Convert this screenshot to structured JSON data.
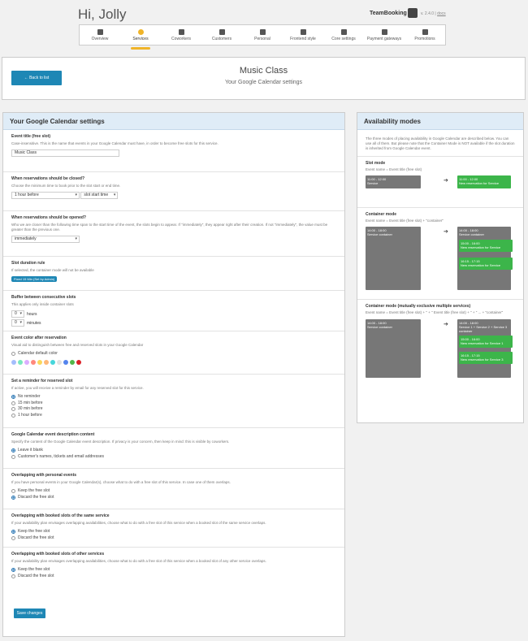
{
  "header": {
    "greeting": "Hi, Jolly",
    "brand": "TeamBooking",
    "version": "v. 2.4.0",
    "docs_link": "docs"
  },
  "nav": {
    "items": [
      {
        "label": "Overview",
        "icon": "overview-icon"
      },
      {
        "label": "Services",
        "icon": "services-icon",
        "active": true
      },
      {
        "label": "Coworkers",
        "icon": "coworkers-icon"
      },
      {
        "label": "Customers",
        "icon": "customers-icon"
      },
      {
        "label": "Personal",
        "icon": "personal-icon"
      },
      {
        "label": "Frontend style",
        "icon": "brush-icon"
      },
      {
        "label": "Core settings",
        "icon": "gear-icon"
      },
      {
        "label": "Payment gateways",
        "icon": "cart-icon"
      },
      {
        "label": "Promotions",
        "icon": "promo-icon"
      }
    ],
    "accent": "#f0b429"
  },
  "titlebar": {
    "back_label": "← Back to list",
    "service_name": "Music Class",
    "subtitle": "Your Google Calendar settings"
  },
  "settings": {
    "title": "Your Google Calendar settings",
    "event_title": {
      "label": "Event title (free slot)",
      "desc": "Case-insensitive. This is the name that events in your Google Calendar must have, in order to become free slots for this service.",
      "value": "Music Class"
    },
    "close": {
      "label": "When reservations should be closed?",
      "desc": "Choose the minimum time to book prior to the slot start or end time.",
      "sel1": "1 hour before",
      "sel2": "slot start time"
    },
    "open": {
      "label": "When reservations should be opened?",
      "desc": "Who we are closer than the following time span to the start time of the event, the slots begin to appear. If \"immediately\", they appear right after their creation. If not \"immediately\", the value must be greater than the previous one.",
      "sel": "immediately"
    },
    "duration": {
      "label": "Slot duration rule",
      "desc": "If selected, the container mode will not be available",
      "pill1": "Fixed 15 Min",
      "pill2": "(Set by Admin)"
    },
    "buffer": {
      "label": "Buffer between consecutive slots",
      "desc": "This applies only inside container slots",
      "hours_val": "0",
      "hours_label": "hours",
      "minutes_val": "0",
      "minutes_label": "minutes"
    },
    "color": {
      "label": "Event color after reservation",
      "desc": "Visual aid to distinguish between free and reserved slots in your Google Calendar",
      "default_label": "Calendar default color",
      "swatches": [
        "#a4bdfc",
        "#7ae7bf",
        "#dbadff",
        "#ff887c",
        "#fbd75b",
        "#ffb878",
        "#46d6db",
        "#e1e1e1",
        "#5484ed",
        "#51b749",
        "#dc2127"
      ]
    },
    "reminder": {
      "label": "Set a reminder for reserved slot",
      "desc": "If active, you will receive a reminder by email for any reserved slot for this service.",
      "options": [
        "No reminder",
        "15 min before",
        "30 min before",
        "1 hour before"
      ],
      "selected": 0
    },
    "description": {
      "label": "Google Calendar event description content",
      "desc": "Specify the content of the Google Calendar event description. If privacy is your concern, then keep in mind: this is visible by coworkers.",
      "options": [
        "Leave it blank",
        "Customer's names, tickets and email addresses"
      ],
      "selected": 0
    },
    "personal": {
      "label": "Overlapping with personal events",
      "desc": "If you have personal events in your Google Calendar(s), choose what to do with a free slot of this service. In case one of them overlaps.",
      "options": [
        "Keep the free slot",
        "Discard the free slot"
      ],
      "selected": 1
    },
    "same_service": {
      "label": "Overlapping with booked slots of the same service",
      "desc": "If your availability plan envisages overlapping availabilities, choose what to do with a free slot of this service when a booked slot of the same service overlaps.",
      "options": [
        "Keep the free slot",
        "Discard the free slot"
      ],
      "selected": 0
    },
    "other_services": {
      "label": "Overlapping with booked slots of other services",
      "desc": "If your availability plan envisages overlapping availabilities, choose what to do with a free slot of this service when a booked slot of any other service overlaps.",
      "options": [
        "Keep the free slot",
        "Discard the free slot"
      ],
      "selected": 0
    },
    "save_label": "Save changes"
  },
  "modes": {
    "title": "Availability modes",
    "intro": "The three modes of placing availability in Google Calendar are described below. You can use all of them. But please note that the Container Mode is NOT available if the slot duration is inherited from Google Calendar event.",
    "slot": {
      "title": "Slot mode",
      "formula": "Event name = Event title (free slot)",
      "gray": "11:00 - 12:00\nService",
      "green": "11:00 - 12:00\nNew reservation for Service"
    },
    "container": {
      "title": "Container mode",
      "formula": "Event name = Event title (free slot) + \"container\"",
      "gray": "14:00 - 18:00\nService container",
      "gray2": "14:00 - 18:00\nService container",
      "green1": "15:00 - 16:00\nNew reservation for Service",
      "green2": "16:15 - 17:15\nNew reservation for Service"
    },
    "multi": {
      "title": "Container mode (mutually exclusive multiple services)",
      "formula": "Event name = Event title (free slot) + \" + \" Event title (free slot) + \" + \" ... + \"container\"",
      "gray": "14:00 - 18:00\nService container",
      "gray2": "14:00 - 18:00\nService 1 + Service 2 + Service 3 container",
      "green1": "15:00 - 16:00\nNew reservation for Service 1",
      "green2": "16:15 - 17:15\nNew reservation for Service 3"
    },
    "arrow": "➔"
  }
}
